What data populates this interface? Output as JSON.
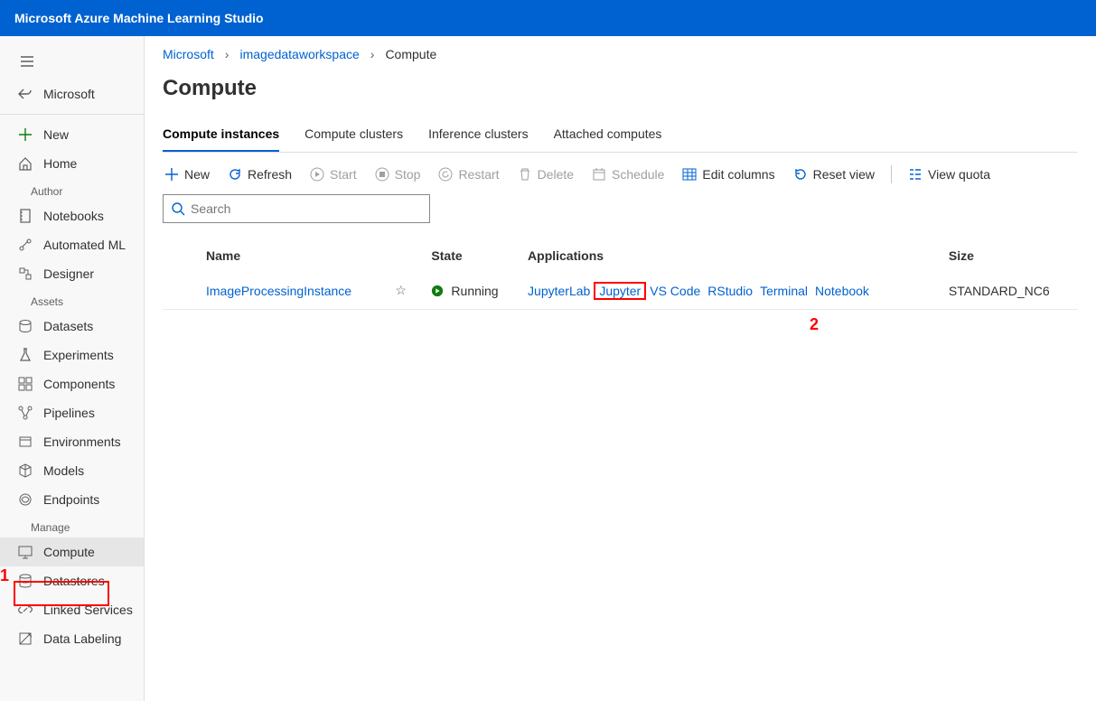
{
  "app": {
    "title": "Microsoft Azure Machine Learning Studio"
  },
  "sidebar": {
    "back": "Microsoft",
    "items": [
      {
        "label": "New"
      },
      {
        "label": "Home"
      }
    ],
    "section_author": "Author",
    "author_items": [
      {
        "label": "Notebooks"
      },
      {
        "label": "Automated ML"
      },
      {
        "label": "Designer"
      }
    ],
    "section_assets": "Assets",
    "assets_items": [
      {
        "label": "Datasets"
      },
      {
        "label": "Experiments"
      },
      {
        "label": "Components"
      },
      {
        "label": "Pipelines"
      },
      {
        "label": "Environments"
      },
      {
        "label": "Models"
      },
      {
        "label": "Endpoints"
      }
    ],
    "section_manage": "Manage",
    "manage_items": [
      {
        "label": "Compute"
      },
      {
        "label": "Datastores"
      },
      {
        "label": "Linked Services"
      },
      {
        "label": "Data Labeling"
      }
    ]
  },
  "breadcrumb": {
    "root": "Microsoft",
    "workspace": "imagedataworkspace",
    "current": "Compute"
  },
  "page": {
    "title": "Compute"
  },
  "tabs": [
    {
      "label": "Compute instances"
    },
    {
      "label": "Compute clusters"
    },
    {
      "label": "Inference clusters"
    },
    {
      "label": "Attached computes"
    }
  ],
  "toolbar": {
    "new": "New",
    "refresh": "Refresh",
    "start": "Start",
    "stop": "Stop",
    "restart": "Restart",
    "delete": "Delete",
    "schedule": "Schedule",
    "editcols": "Edit columns",
    "resetview": "Reset view",
    "viewquota": "View quota"
  },
  "search": {
    "placeholder": "Search"
  },
  "table": {
    "cols": {
      "name": "Name",
      "state": "State",
      "applications": "Applications",
      "size": "Size"
    },
    "rows": [
      {
        "name": "ImageProcessingInstance",
        "state": "Running",
        "apps": [
          "JupyterLab",
          "Jupyter",
          "VS Code",
          "RStudio",
          "Terminal",
          "Notebook"
        ],
        "size": "STANDARD_NC6"
      }
    ]
  },
  "annotations": {
    "one": "1",
    "two": "2"
  }
}
